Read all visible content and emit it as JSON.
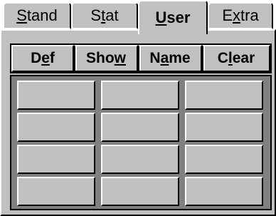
{
  "tabs": [
    {
      "label_pre": "",
      "label_ul": "S",
      "label_post": "tand",
      "selected": false
    },
    {
      "label_pre": "S",
      "label_ul": "t",
      "label_post": "at",
      "selected": false
    },
    {
      "label_pre": "",
      "label_ul": "U",
      "label_post": "ser",
      "selected": true
    },
    {
      "label_pre": "E",
      "label_ul": "x",
      "label_post": "tra",
      "selected": false
    }
  ],
  "header": {
    "def": {
      "pre": "D",
      "ul": "e",
      "post": "f"
    },
    "show": {
      "pre": "Sho",
      "ul": "w",
      "post": ""
    },
    "name": {
      "pre": "N",
      "ul": "a",
      "post": "me"
    },
    "clear": {
      "pre": "C",
      "ul": "l",
      "post": "ear"
    }
  },
  "grid": {
    "rows": 4,
    "cols": 3
  },
  "colors": {
    "face": "#c0c0c0",
    "highlight": "#ffffff",
    "shadow": "#000000",
    "dark": "#808080"
  }
}
